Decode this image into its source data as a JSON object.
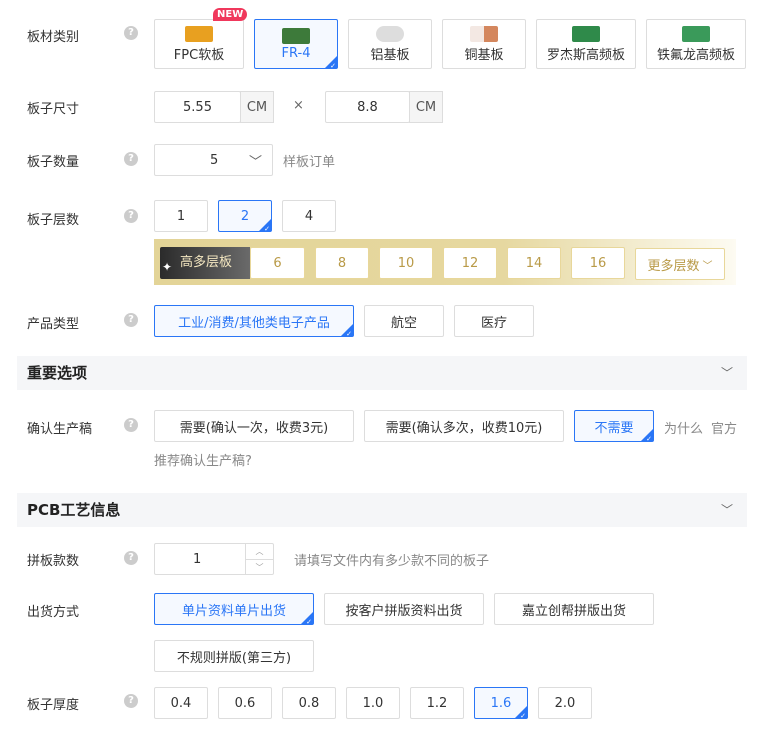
{
  "board_type": {
    "label": "板材类别",
    "badge": "NEW",
    "options": [
      "FPC软板",
      "FR-4",
      "铝基板",
      "铜基板",
      "罗杰斯高频板",
      "铁氟龙高频板"
    ],
    "selected": 1
  },
  "board_size": {
    "label": "板子尺寸",
    "width": "5.55",
    "height": "8.8",
    "unit": "CM",
    "times": "×"
  },
  "quantity": {
    "label": "板子数量",
    "value": "5",
    "note": "样板订单"
  },
  "layers": {
    "label": "板子层数",
    "options": [
      "1",
      "2",
      "4"
    ],
    "selected": 1,
    "high_label": "高多层板",
    "high_options": [
      "6",
      "8",
      "10",
      "12",
      "14",
      "16"
    ],
    "more": "更多层数"
  },
  "product_type": {
    "label": "产品类型",
    "options": [
      "工业/消费/其他类电子产品",
      "航空",
      "医疗"
    ],
    "selected": 0
  },
  "section_important": "重要选项",
  "confirm": {
    "label": "确认生产稿",
    "options": [
      "需要(确认一次，收费3元)",
      "需要(确认多次，收费10元)",
      "不需要"
    ],
    "selected": 2,
    "why": "为什么",
    "official": "官方",
    "recommend": "推荐确认生产稿?"
  },
  "section_pcb": "PCB工艺信息",
  "panel_count": {
    "label": "拼板款数",
    "value": "1",
    "hint": "请填写文件内有多少款不同的板子"
  },
  "shipping": {
    "label": "出货方式",
    "options": [
      "单片资料单片出货",
      "按客户拼版资料出货",
      "嘉立创帮拼版出货",
      "不规则拼版(第三方)"
    ],
    "selected": 0
  },
  "thickness": {
    "label": "板子厚度",
    "options": [
      "0.4",
      "0.6",
      "0.8",
      "1.0",
      "1.2",
      "1.6",
      "2.0"
    ],
    "selected": 5
  },
  "help": "?"
}
